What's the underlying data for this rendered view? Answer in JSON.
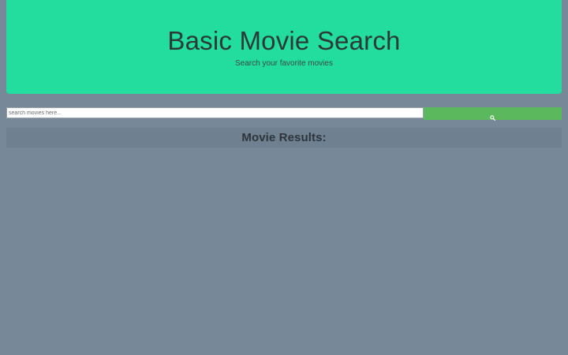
{
  "hero": {
    "title": "Basic Movie Search",
    "subtitle": "Search your favorite movies"
  },
  "search": {
    "placeholder": "search movies here...",
    "value": "",
    "button_icon": "search-icon"
  },
  "results": {
    "heading": "Movie Results:",
    "items": []
  },
  "colors": {
    "page_background": "#778899",
    "hero_background": "#22dd9e",
    "button_background": "#5cb85c",
    "results_bar_background": "#6f8090"
  }
}
